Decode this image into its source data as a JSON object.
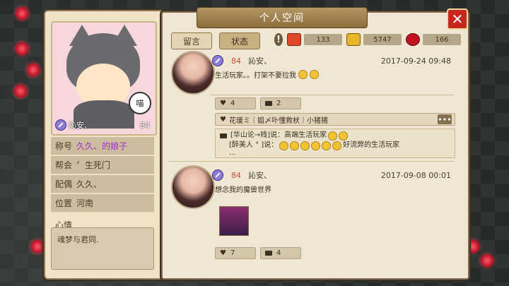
{
  "window": {
    "title": "个人空间"
  },
  "tabs": [
    {
      "label": "留言",
      "active": false
    },
    {
      "label": "状态",
      "active": true
    }
  ],
  "stats": {
    "gifts": "133",
    "popularity": "5747",
    "flowers": "166"
  },
  "icons": {
    "info": "!",
    "close": "✕",
    "more": "•••",
    "meow": "喵"
  },
  "profile": {
    "name": "訫安、",
    "level": "84",
    "fields": [
      {
        "label": "称号",
        "value": "久久、的娘子",
        "value_color": "#a12ad1"
      },
      {
        "label": "帮会",
        "value": "〞生死门",
        "value_color": "#4a3e2c"
      },
      {
        "label": "配偶",
        "value": "久久、",
        "value_color": "#4a3e2c"
      },
      {
        "label": "位置",
        "value": "河南",
        "value_color": "#4a3e2c"
      }
    ],
    "mood_label": "心情",
    "mood_text": "魂梦与君同."
  },
  "posts": [
    {
      "name": "訫安、",
      "level": "84",
      "time": "2017-09-24 09:48",
      "text": "生活玩家。。打架不要拉我",
      "likes": "4",
      "comments": "2",
      "liked_by": "花瑗ミ｜姐〆卟懂救枤｜小猪猪",
      "comment_lines": [
        "[华山论→贱]说：高端生活玩家",
        "[醉美人 ° ]说：",
        "好流弊的生活玩家"
      ],
      "ellipsis": "..."
    },
    {
      "name": "訫安、",
      "level": "84",
      "time": "2017-09-08 00:01",
      "text": "想念我的魔兽世界",
      "likes": "7",
      "comments": "4"
    }
  ]
}
